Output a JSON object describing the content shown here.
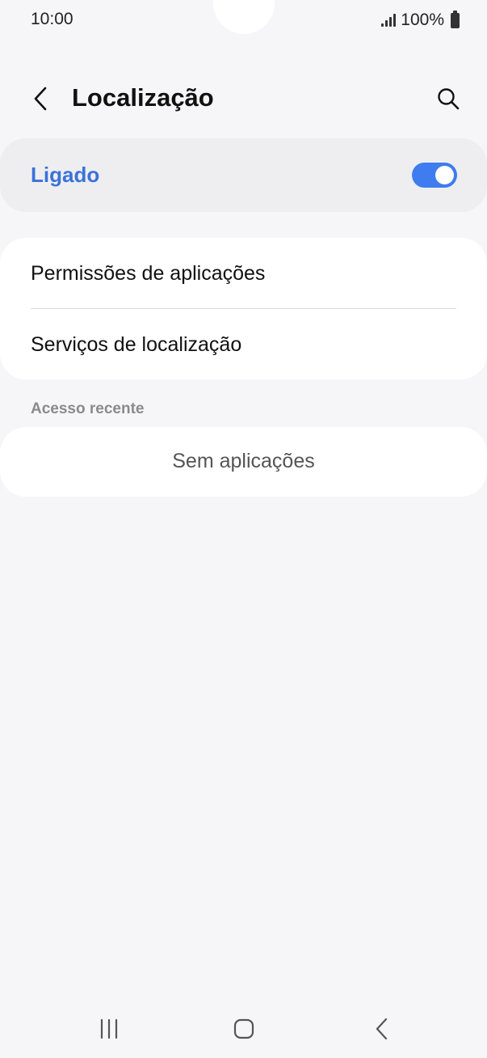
{
  "status_bar": {
    "time": "10:00",
    "battery": "100%",
    "icons": [
      "signal-icon",
      "battery-icon"
    ]
  },
  "header": {
    "title": "Localização",
    "back_icon": "chevron-left-icon",
    "search_icon": "search-icon"
  },
  "master_toggle": {
    "label": "Ligado",
    "state": "on",
    "accent_color": "#3e7cf0",
    "label_color": "#3b72d9"
  },
  "settings": {
    "items": [
      {
        "label": "Permissões de aplicações"
      },
      {
        "label": "Serviços de localização"
      }
    ]
  },
  "recent_access": {
    "header": "Acesso recente",
    "empty_text": "Sem aplicações"
  },
  "nav_bar": {
    "icons": [
      "recent-apps-icon",
      "home-icon",
      "back-icon"
    ]
  }
}
